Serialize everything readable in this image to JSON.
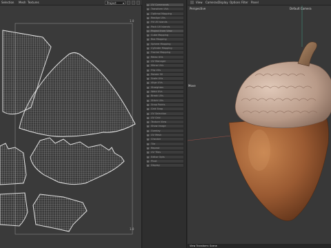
{
  "uv_menu": {
    "items": [
      "Selection",
      "Mesh",
      "Textures"
    ],
    "projection_select": "Project"
  },
  "uv_editor": {
    "top_right_marker": "1.0",
    "bottom_right_marker": "1.0"
  },
  "tool_panel": {
    "rows": [
      "UV Commands",
      "Transform UVs",
      "Optimal Mapping",
      "Realign UVs",
      "Fit UV Islands",
      "Pack UV Islands",
      "Project from View",
      "Cube Mapping",
      "Box Mapping",
      "Sphere Mapping",
      "Cylinder Mapping",
      "Frontal Mapping",
      "Relax UVs",
      "UV Manager",
      "Mirror UVs",
      "Flip UVs",
      "Rotate 90",
      "Scale UVs",
      "Align UVs",
      "Straighten",
      "Weld UVs",
      "Break UVs",
      "Stitch UVs",
      "Snap Points",
      "Grid Snap",
      "UV Selection",
      "UV Grid",
      "Texture View",
      "Show Image",
      "Overlay",
      "UV Mesh",
      "Checker",
      "Tile",
      "Repeat",
      "UV Tiles",
      "Editor Opts",
      "Pivot",
      "Display"
    ]
  },
  "viewport_menu": {
    "items": [
      "View",
      "Cameras",
      "Display",
      "Options",
      "Filter",
      "Panel"
    ]
  },
  "viewport": {
    "camera_mode": "Perspective",
    "camera_name": "Default Camera",
    "axis_label": "Move",
    "status": "View Transform: Scene"
  },
  "colors": {
    "uv_background": "#3a3a3a",
    "uv_wire": "#d8d8d8",
    "viewport_background": "#383838",
    "acorn_cap": "#b89a88",
    "acorn_body": "#9a5a32"
  }
}
